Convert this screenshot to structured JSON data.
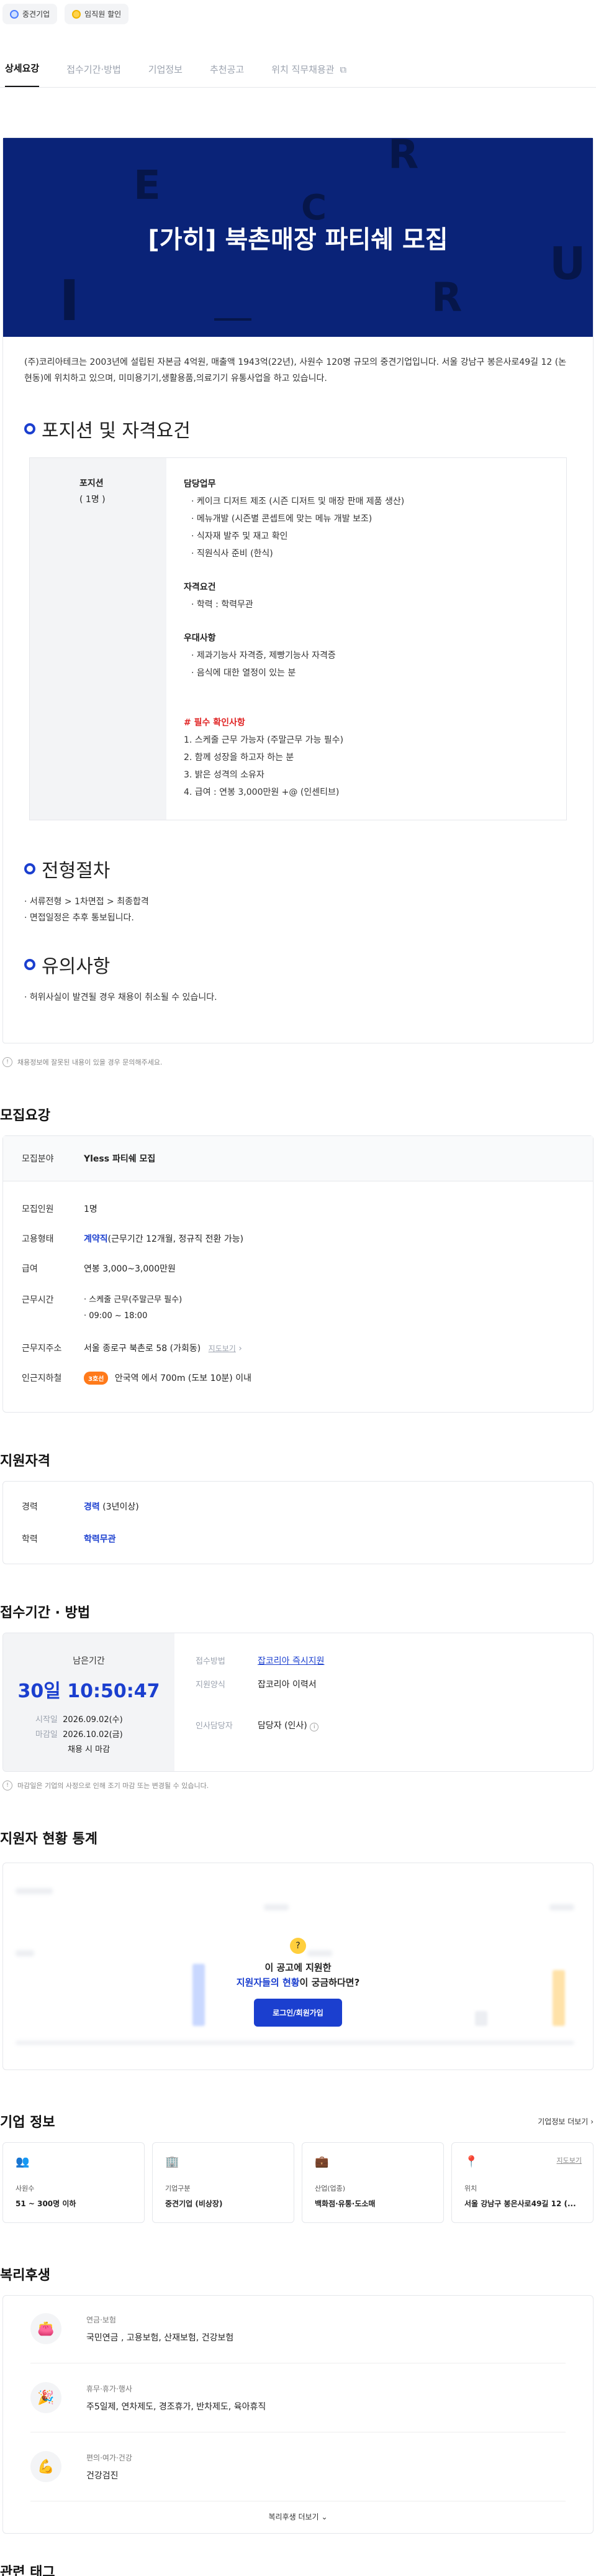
{
  "badges": [
    {
      "label": "중견기업",
      "icon": "building-icon"
    },
    {
      "label": "임직원 할인",
      "icon": "coin-icon"
    }
  ],
  "tabs": [
    "상세요강",
    "접수기간·방법",
    "기업정보",
    "추천공고",
    "위치 직무채용관"
  ],
  "banner": {
    "title": "[가히] 북촌매장 파티쉐 모집",
    "letters": [
      "E",
      "R",
      "C",
      "U",
      "I",
      "R"
    ],
    "bg_color": "#0a2378"
  },
  "intro": "(주)코리아테크는 2003년에 설립된 자본금 4억원, 매출액 1943억(22년), 사원수 120명 규모의 중견기업입니다. 서울 강남구 봉은사로49길 12 (논현동)에 위치하고 있으며, 미미용기기,생활용품,의료기기 유통사업을 하고 있습니다.",
  "position_section": {
    "heading": "포지션 및 자격요건",
    "left_title": "포지션",
    "left_count": "( 1명 )",
    "duty_title": "담당업무",
    "duties": [
      "· 케이크 디저트 제조 (시즌 디저트 및 매장 판매 제품 생산)",
      "· 메뉴개발 (시즌별 콘셉트에 맞는 메뉴 개발 보조)",
      "· 식자재 발주 및 재고 확인",
      "· 직원식사 준비 (한식)"
    ],
    "qual_title": "자격요건",
    "quals": [
      "· 학력 : 학력무관"
    ],
    "pref_title": "우대사항",
    "prefs": [
      "· 제과기능사 자격증, 제빵기능사 자격증",
      "· 음식에 대한 열정이 있는 분"
    ],
    "must_title": "# 필수 확인사항",
    "musts": [
      "1. 스케줄 근무 가능자 (주말근무 가능 필수)",
      "2. 함께 성장을 하고자 하는 분",
      "3. 밝은 성격의 소유자",
      "4. 급여 : 연봉 3,000만원 +@ (인센티브)"
    ]
  },
  "process_section": {
    "heading": "전형절차",
    "items": [
      "· 서류전형 > 1차면접 > 최종합격",
      "· 면접일정은 추후 통보됩니다."
    ]
  },
  "caution_section": {
    "heading": "유의사항",
    "items": [
      "· 허위사실이 발견될 경우 채용이 취소될 수 있습니다."
    ]
  },
  "report_notice": "채용정보에 잘못된 내용이 있을 경우 문의해주세요.",
  "summary": {
    "heading": "모집요강",
    "field_label": "모집분야",
    "field_value": "Yless 파티쉐 모집",
    "headcount_label": "모집인원",
    "headcount_value": "1명",
    "type_label": "고용형태",
    "type_value_blue": "계약직",
    "type_value_rest": "(근무기간 12개월, 정규직 전환 가능)",
    "salary_label": "급여",
    "salary_value": "연봉 3,000~3,000만원",
    "hours_label": "근무시간",
    "hours_values": [
      "· 스케줄 근무(주말근무 필수)",
      "· 09:00 ~ 18:00"
    ],
    "address_label": "근무지주소",
    "address_value": "서울 종로구 북촌로 58 (가회동)",
    "map_link": "지도보기",
    "station_label": "인근지하철",
    "station_badge": "3호선",
    "station_value": "안국역 에서 700m (도보 10분) 이내"
  },
  "qualification": {
    "heading": "지원자격",
    "career_label": "경력",
    "career_blue": "경력",
    "career_rest": "(3년이상)",
    "edu_label": "학력",
    "edu_value": "학력무관"
  },
  "apply": {
    "heading": "접수기간 · 방법",
    "remain_label": "남은기간",
    "remain_value": "30일 10:50:47",
    "start_label": "시작일",
    "start_value": "2026.09.02(수)",
    "end_label": "마감일",
    "end_value": "2026.10.02(금)",
    "end_note": "채용 시 마감",
    "method_label": "접수방법",
    "method_value": "잡코리아 즉시지원",
    "form_label": "지원양식",
    "form_value": "잡코리아 이력서",
    "manager_label": "인사담당자",
    "manager_value": "담당자 (인사)",
    "notice": "마감일은 기업의 사정으로 인해 조기 마감 또는 변경될 수 있습니다."
  },
  "stats": {
    "heading": "지원자 현황 통계",
    "overlay_line1": "이 공고에 지원한",
    "overlay_line2_blue": "지원자들의 현황",
    "overlay_line2_rest": "이 궁금하다면?",
    "button": "로그인/회원가입"
  },
  "company": {
    "heading": "기업 정보",
    "more": "기업정보 더보기",
    "cards": [
      {
        "icon": "people-icon",
        "label": "사원수",
        "value": "51 ~ 300명 이하"
      },
      {
        "icon": "building-icon",
        "label": "기업구분",
        "value": "중견기업 (비상장)"
      },
      {
        "icon": "briefcase-icon",
        "label": "산업(업종)",
        "value": "백화점·유통·도소매"
      },
      {
        "icon": "pin-icon",
        "label": "위치",
        "value": "서울 강남구 봉은사로49길 12 (...",
        "link": "지도보기"
      }
    ]
  },
  "benefits": {
    "heading": "복리후생",
    "items": [
      {
        "icon": "wallet-icon",
        "title": "연금·보험",
        "value": "국민연금 , 고용보험, 산재보험, 건강보험"
      },
      {
        "icon": "party-icon",
        "title": "휴무·휴가·행사",
        "value": "주5일제, 연차제도, 경조휴가, 반차제도, 육아휴직"
      },
      {
        "icon": "health-icon",
        "title": "편의·여가·건강",
        "value": "건강검진"
      }
    ],
    "more": "복리후생 더보기"
  },
  "tags_heading": "관련 태그"
}
